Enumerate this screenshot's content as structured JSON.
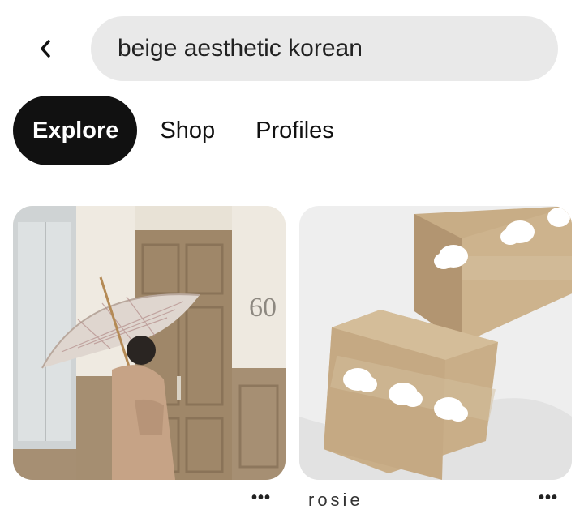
{
  "search": {
    "query": "beige aesthetic korean"
  },
  "tabs": [
    {
      "label": "Explore",
      "active": true
    },
    {
      "label": "Shop",
      "active": false
    },
    {
      "label": "Profiles",
      "active": false
    }
  ],
  "pins": [
    {
      "image": "woman with checked umbrella in beige coat at door numbered 60",
      "door_number": "60",
      "title": "",
      "more": "•••"
    },
    {
      "image": "kraft cardboard boxes with white cloud stickers",
      "title": "rosie",
      "more": "•••"
    }
  ],
  "icons": {
    "back": "chevron-left-icon",
    "more": "more-dots-icon"
  }
}
